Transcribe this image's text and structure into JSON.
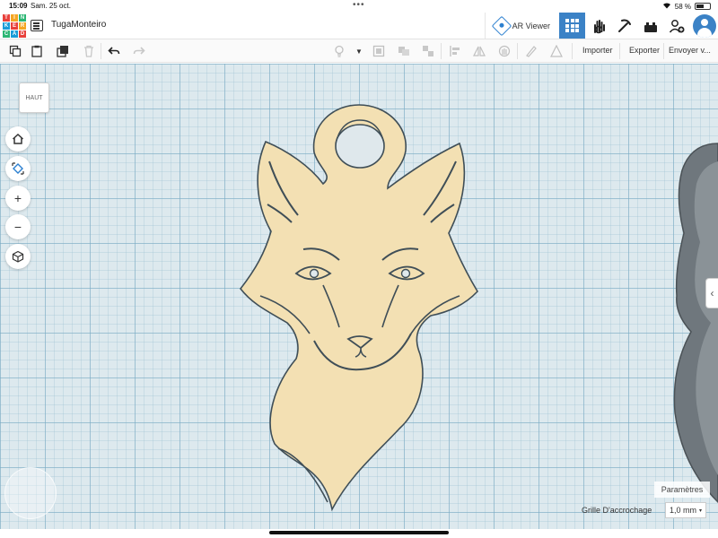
{
  "status_bar": {
    "time": "15:09",
    "date": "Sam. 25 oct.",
    "battery_percent": "58 %",
    "battery_level": 0.58
  },
  "app": {
    "logo_letters": [
      "T",
      "I",
      "N",
      "K",
      "E",
      "R",
      "C",
      "A",
      "D"
    ],
    "logo_colors": [
      "#e8413c",
      "#f5a623",
      "#2bb673",
      "#1a9cd8",
      "#e8413c",
      "#f5a623",
      "#2bb673",
      "#1a9cd8",
      "#e8413c"
    ],
    "project_name": "TugaMonteiro",
    "accent": "#3b82c6"
  },
  "topbar": {
    "ar_viewer_label": "AR Viewer",
    "icons": [
      "grid-view-icon",
      "tinker-hand-icon",
      "pickaxe-icon",
      "bricks-icon",
      "add-user-icon",
      "avatar"
    ]
  },
  "toolbar": {
    "import_label": "Importer",
    "export_label": "Exporter",
    "send_label": "Envoyer v..."
  },
  "viewcube": {
    "label": "HAUT"
  },
  "bottom": {
    "params_label": "Paramètres",
    "snap_label": "Grille D'accrochage",
    "snap_value": "1,0 mm"
  },
  "model": {
    "fill": "#f3e0b3",
    "outline": "#3f4e57",
    "second_shape": "#6f777d"
  }
}
